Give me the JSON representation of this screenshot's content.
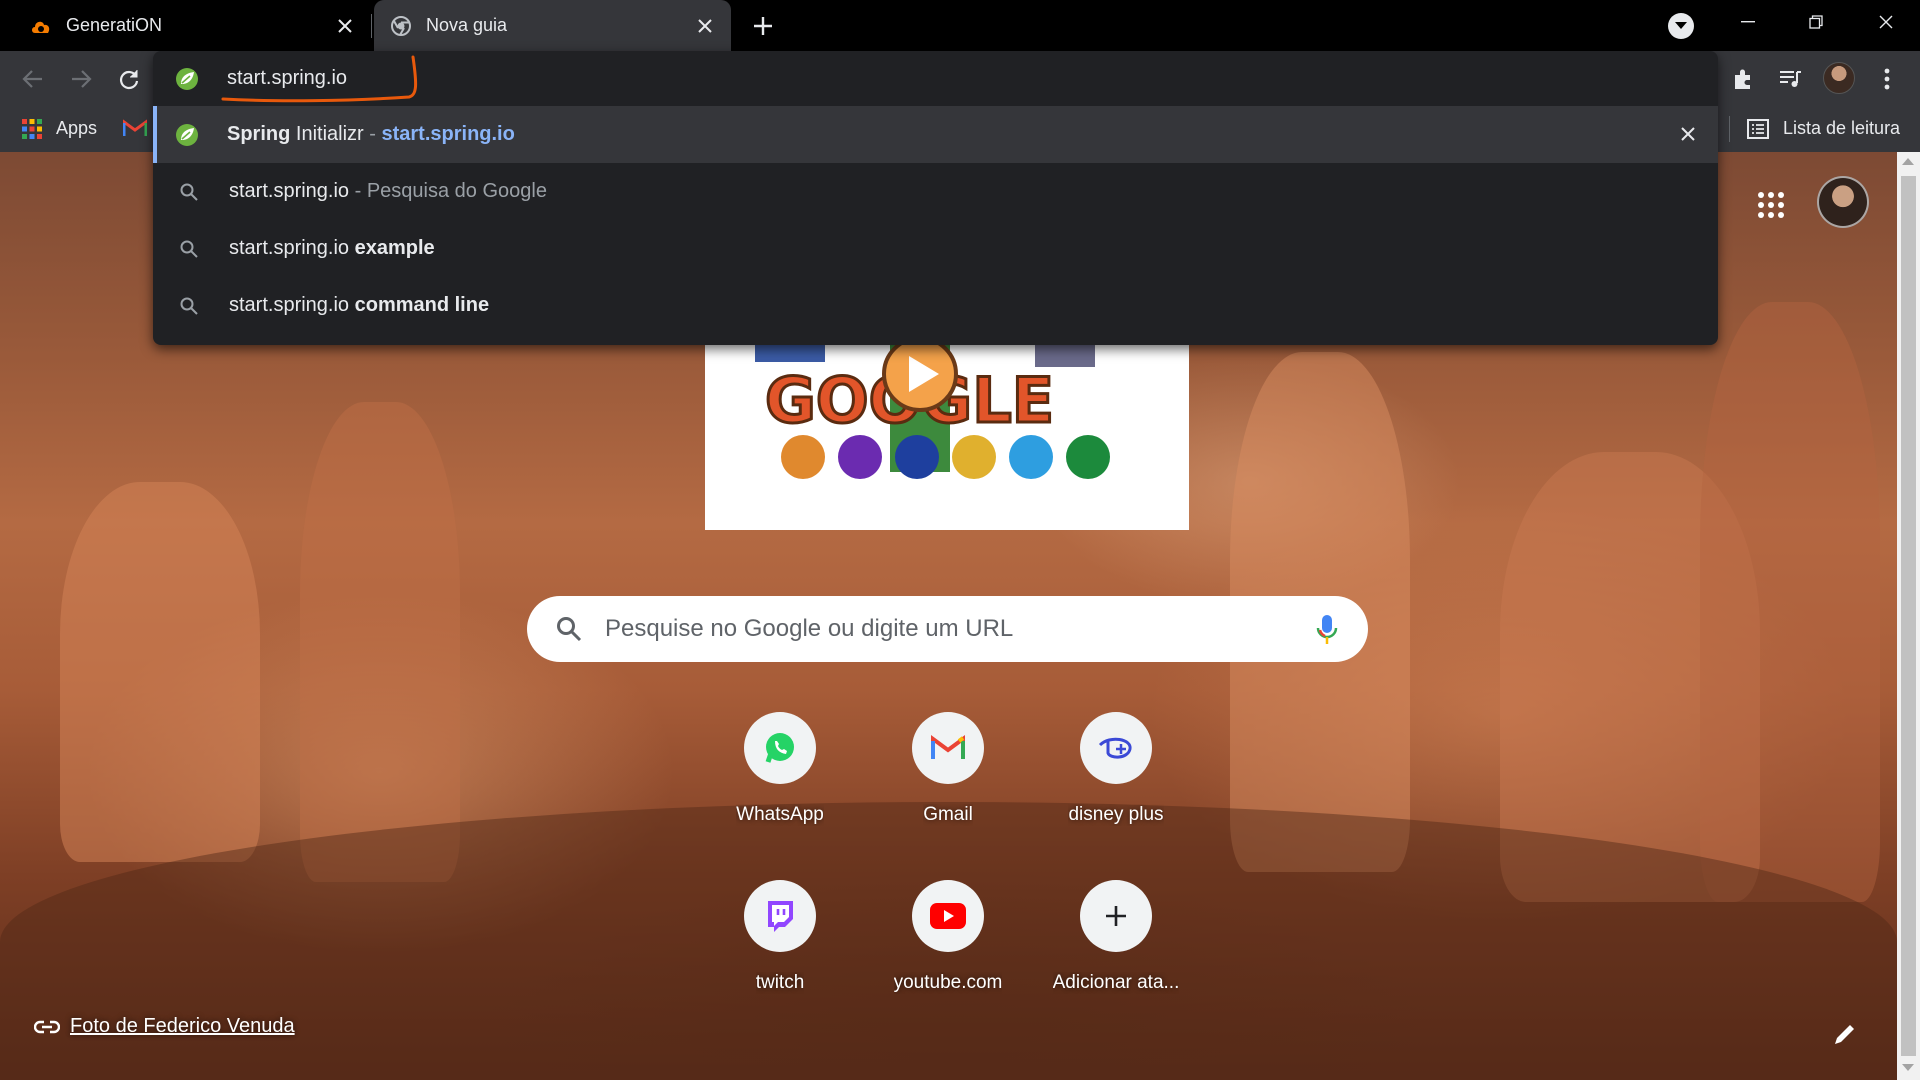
{
  "tabs": [
    {
      "title": "GeneratiON",
      "favicon": "cloud-logo-icon",
      "active": false
    },
    {
      "title": "Nova guia",
      "favicon": "chrome-icon",
      "active": true
    }
  ],
  "omnibox": {
    "text": "start.spring.io",
    "suggestions": [
      {
        "icon": "spring-favicon-icon",
        "bold": "Spring",
        "normal": " Initializr",
        "sep": " - ",
        "url": "start.spring.io",
        "selected": true
      },
      {
        "icon": "search-icon",
        "query": "start.spring.io",
        "suffix": " - Pesquisa do Google"
      },
      {
        "icon": "search-icon",
        "query": "start.spring.io ",
        "bold": "example"
      },
      {
        "icon": "search-icon",
        "query": "start.spring.io ",
        "bold": "command line"
      }
    ]
  },
  "bookmarks": {
    "apps_label": "Apps",
    "reading_list_label": "Lista de leitura"
  },
  "ntp": {
    "search_placeholder": "Pesquise no Google ou digite um URL",
    "shortcuts": [
      {
        "label": "WhatsApp",
        "icon": "whatsapp-icon"
      },
      {
        "label": "Gmail",
        "icon": "gmail-icon"
      },
      {
        "label": "disney plus",
        "icon": "disney-plus-icon"
      },
      {
        "label": "twitch",
        "icon": "twitch-icon"
      },
      {
        "label": "youtube.com",
        "icon": "youtube-icon"
      },
      {
        "label": "Adicionar ata...",
        "icon": "add-icon"
      }
    ],
    "photo_credit": "Foto de Federico Venuda",
    "doodle_letters": "GOOGLE"
  },
  "colors": {
    "accent_blue": "#8ab4f8",
    "annotation_orange": "#e8590c",
    "spring_green": "#6db33f",
    "frame": "#000000",
    "toolbar": "#35363a"
  }
}
